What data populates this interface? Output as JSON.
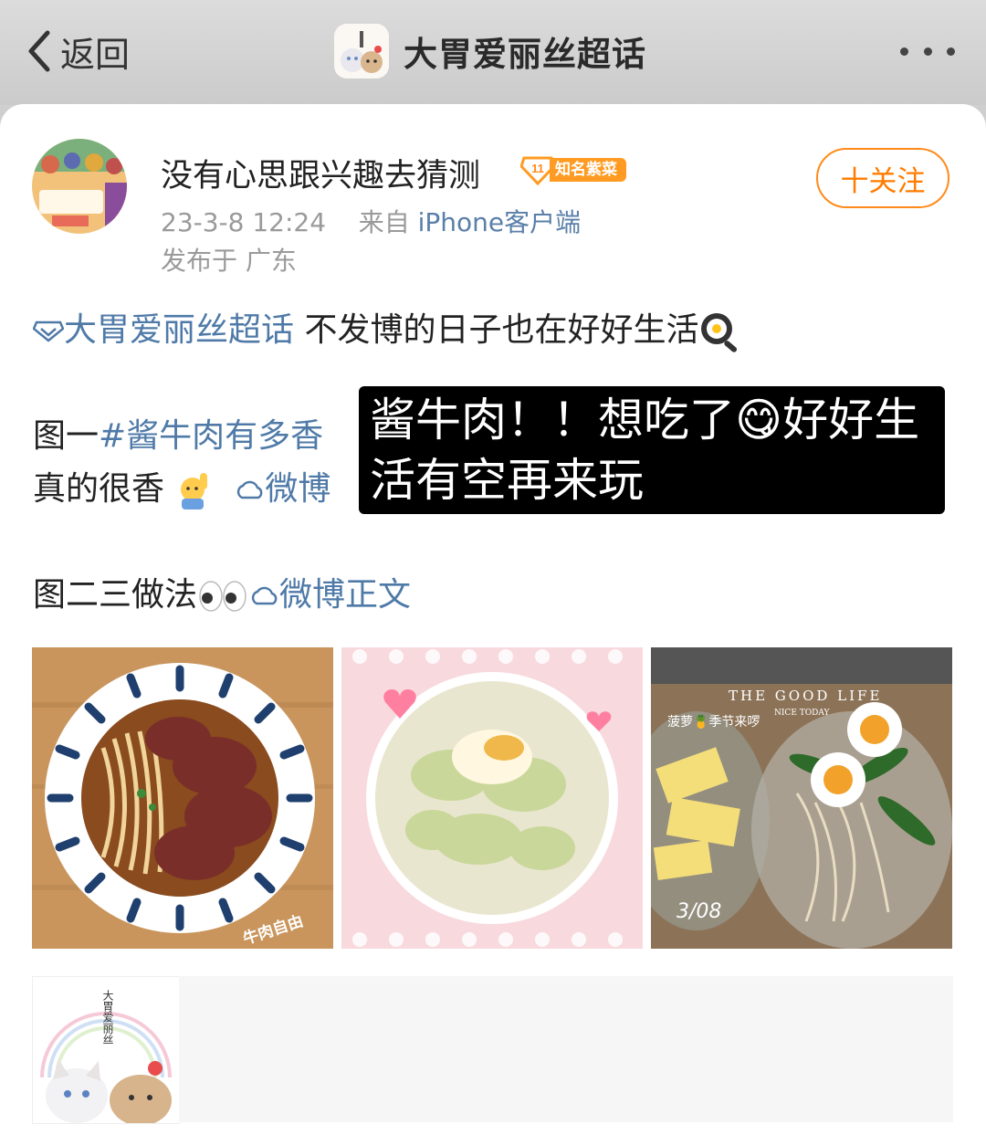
{
  "nav": {
    "back_label": "返回",
    "title": "大胃爱丽丝超话"
  },
  "post": {
    "username": "没有心思跟兴趣去猜测",
    "level": "11",
    "badge_text": "知名紫菜",
    "follow_label": "十关注",
    "date": "23-3-8 12:24",
    "from_label": "来自",
    "source": "iPhone客户端",
    "location": "发布于 广东"
  },
  "content": {
    "topic": "大胃爱丽丝超话",
    "line1_text": "不发博的日子也在好好生活",
    "line2_prefix": "图一",
    "line2_hashtag": "#酱牛肉有多香",
    "line3_text": "真的很香",
    "line3_link": "微博",
    "line4_text": "图二三做法",
    "line4_link": "微博正文"
  },
  "overlay": {
    "text": "酱牛肉！！想吃了😋好好生活有空再来玩"
  },
  "images": {
    "img1_caption": "牛肉自由",
    "img3_title": "THE GOOD LIFE",
    "img3_subtitle": "NICE TODAY",
    "img3_label": "菠萝🍍季节来啰",
    "img3_date": "3/08",
    "img4_text": "大胃爱丽丝"
  },
  "colors": {
    "accent": "#ff8a1a",
    "link": "#4f7aa8"
  }
}
